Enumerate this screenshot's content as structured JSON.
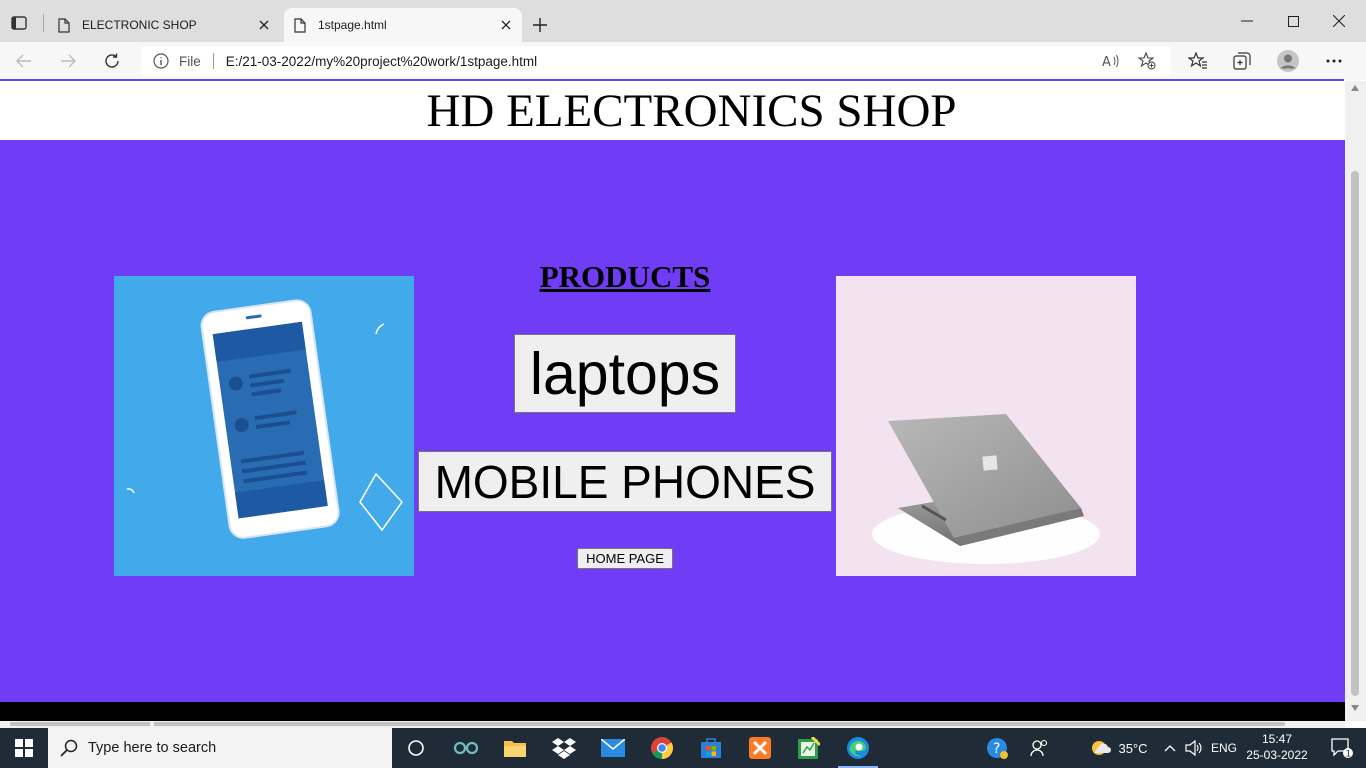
{
  "browser": {
    "tabs": [
      {
        "label": "ELECTRONIC SHOP",
        "active": false
      },
      {
        "label": "1stpage.html",
        "active": true
      }
    ],
    "address": {
      "scheme_label": "File",
      "url": "E:/21-03-2022/my%20project%20work/1stpage.html"
    }
  },
  "page": {
    "title": "HD ELECTRONICS SHOP",
    "products_heading": "PRODUCTS",
    "buttons": {
      "laptops": "laptops",
      "mobile_phones": "MOBILE PHONES",
      "home_page": "HOME PAGE"
    },
    "colors": {
      "hero_background": "#713cf5",
      "phone_image_background": "#42a9ea",
      "laptop_image_background": "#f3e2ef"
    },
    "images": [
      "smartphone-illustration",
      "laptop-photo"
    ]
  },
  "taskbar": {
    "search_placeholder": "Type here to search",
    "apps": [
      "task-view",
      "arduino",
      "file-explorer",
      "dropbox",
      "mail",
      "chrome",
      "microsoft-store",
      "xampp",
      "sticky-app",
      "edge"
    ],
    "weather": "35°C",
    "language": "ENG",
    "time": "15:47",
    "date": "25-03-2022",
    "notification_count": "1"
  }
}
